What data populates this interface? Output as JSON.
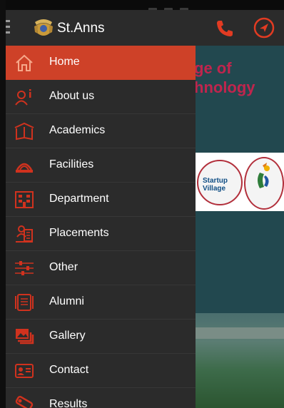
{
  "app": {
    "title": "St.Anns"
  },
  "background": {
    "headline_line1": "ge of",
    "headline_line2": "hnology",
    "partner_logo_text": "Startup Village"
  },
  "colors": {
    "accent": "#ce4128",
    "drawer_bg": "#2b2b2b",
    "icon_red": "#d0321e"
  },
  "menu": {
    "items": [
      {
        "label": "Home",
        "icon": "home-icon",
        "active": true
      },
      {
        "label": "About us",
        "icon": "about-icon",
        "active": false
      },
      {
        "label": "Academics",
        "icon": "book-icon",
        "active": false
      },
      {
        "label": "Facilities",
        "icon": "facilities-icon",
        "active": false
      },
      {
        "label": "Department",
        "icon": "department-icon",
        "active": false
      },
      {
        "label": "Placements",
        "icon": "placements-icon",
        "active": false
      },
      {
        "label": "Other",
        "icon": "sliders-icon",
        "active": false
      },
      {
        "label": "Alumni",
        "icon": "alumni-icon",
        "active": false
      },
      {
        "label": "Gallery",
        "icon": "gallery-icon",
        "active": false
      },
      {
        "label": "Contact",
        "icon": "contact-icon",
        "active": false
      },
      {
        "label": "Results",
        "icon": "results-icon",
        "active": false
      }
    ]
  }
}
